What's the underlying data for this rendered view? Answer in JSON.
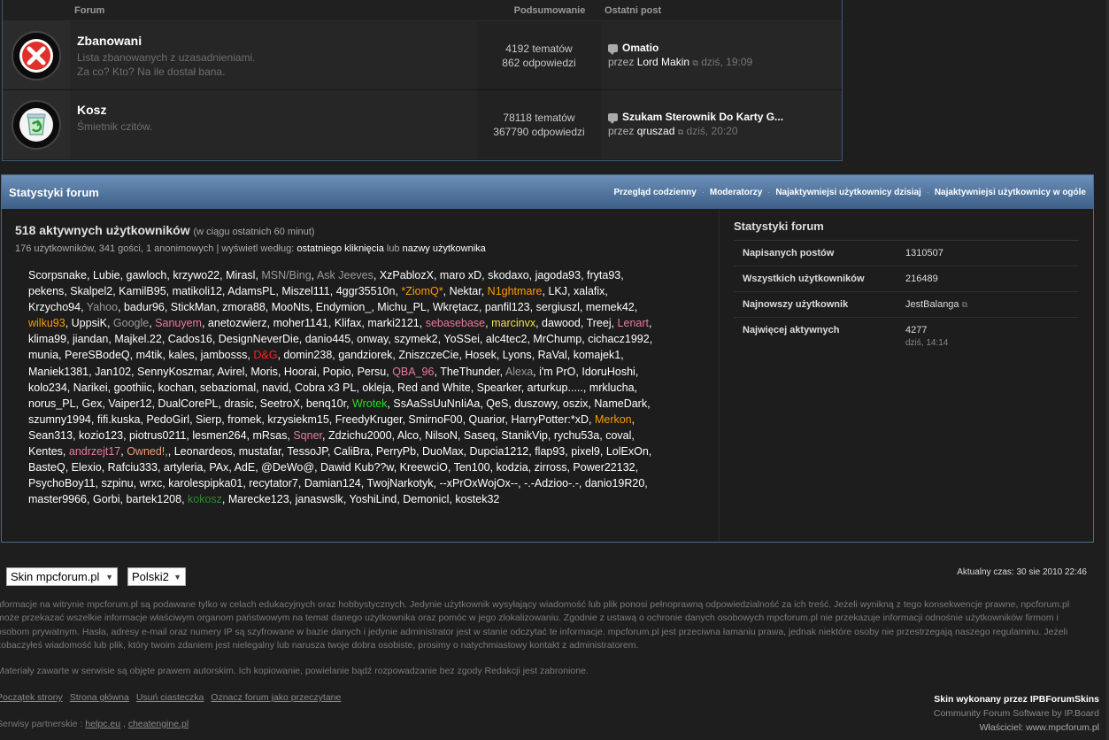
{
  "forum_table": {
    "headers": {
      "forum": "Forum",
      "summary": "Podsumowanie",
      "last_post": "Ostatni post"
    },
    "rows": [
      {
        "title": "Zbanowani",
        "desc1": "Lista zbanowanych z uzasadnieniami.",
        "desc2": "Za co? Kto? Na ile dostał bana.",
        "topics": "4192 tematów",
        "replies": "862 odpowiedzi",
        "last_topic": "Omatio",
        "by_label": "przez",
        "last_user": "Lord Makin",
        "last_time": "dziś, 19:09"
      },
      {
        "title": "Kosz",
        "desc1": "Śmietnik czitów.",
        "desc2": "",
        "topics": "78118 tematów",
        "replies": "367790 odpowiedzi",
        "last_topic": "Szukam Sterownik Do Karty G...",
        "by_label": "przez",
        "last_user": "qruszad",
        "last_time": "dziś, 20:20"
      }
    ]
  },
  "stats": {
    "title": "Statystyki forum",
    "links": [
      "Przegląd codzienny",
      "Moderatorzy",
      "Najaktywniejsi użytkownicy dzisiaj",
      "Najaktywniejsi użytkownicy w ogóle"
    ],
    "active_title": "518 aktywnych użytkowników",
    "active_sub": "(w ciągu ostatnich 60 minut)",
    "meta_prefix": "176 użytkowników, 341 gości, 1 anonimowych | wyświetl według:",
    "meta_link1": "ostatniego kliknięcia",
    "meta_or": "lub",
    "meta_link2": "nazwy użytkownika",
    "users": [
      [
        "Scorpsnake",
        ""
      ],
      [
        "Lubie",
        ""
      ],
      [
        "gawloch",
        ""
      ],
      [
        "krzywo22",
        ""
      ],
      [
        "Mirasl",
        ""
      ],
      [
        "MSN/Bing",
        "gray"
      ],
      [
        "Ask Jeeves",
        "gray"
      ],
      [
        "XzPablozX",
        ""
      ],
      [
        "maro xD",
        ""
      ],
      [
        "skodaxo",
        ""
      ],
      [
        "jagoda93",
        ""
      ],
      [
        "fryta93",
        ""
      ],
      [
        "pekens",
        ""
      ],
      [
        "Skalpel2",
        ""
      ],
      [
        "KamilB95",
        ""
      ],
      [
        "matikoli12",
        ""
      ],
      [
        "AdamsPL",
        ""
      ],
      [
        "Miszel111",
        ""
      ],
      [
        "4ggr35510n",
        ""
      ],
      [
        "*ZiomQ*",
        "orange"
      ],
      [
        "Nektar",
        ""
      ],
      [
        "N1ghtmare",
        "orange"
      ],
      [
        "LKJ",
        ""
      ],
      [
        "xalafix",
        ""
      ],
      [
        "Krzycho94",
        ""
      ],
      [
        "Yahoo",
        "gray"
      ],
      [
        "badur96",
        ""
      ],
      [
        "StickMan",
        ""
      ],
      [
        "zmora88",
        ""
      ],
      [
        "MooNts",
        ""
      ],
      [
        "Endymion_",
        ""
      ],
      [
        "Michu_PL",
        ""
      ],
      [
        "Wkrętacz",
        ""
      ],
      [
        "panfil123",
        ""
      ],
      [
        "sergiuszl",
        ""
      ],
      [
        "memek42",
        ""
      ],
      [
        "wilku93",
        "orange"
      ],
      [
        "UppsiK",
        ""
      ],
      [
        "Google",
        "gray"
      ],
      [
        "Sanuyem",
        "pink"
      ],
      [
        "anetozwierz",
        ""
      ],
      [
        "moher1141",
        ""
      ],
      [
        "Klifax",
        ""
      ],
      [
        "marki2121",
        ""
      ],
      [
        "sebasebase",
        "pink"
      ],
      [
        "marcinvx",
        "yellow"
      ],
      [
        "dawood",
        ""
      ],
      [
        "Treej",
        ""
      ],
      [
        "Lenart",
        "pink"
      ],
      [
        "klima99",
        ""
      ],
      [
        "jiandan",
        ""
      ],
      [
        "Majkel.22",
        ""
      ],
      [
        "Cados16",
        ""
      ],
      [
        "DesignNeverDie",
        ""
      ],
      [
        "danio445",
        ""
      ],
      [
        "onway",
        ""
      ],
      [
        "szymek2",
        ""
      ],
      [
        "YoSSei",
        ""
      ],
      [
        "alc4tec2",
        ""
      ],
      [
        "MrChump",
        ""
      ],
      [
        "cichacz1992",
        ""
      ],
      [
        "munia",
        ""
      ],
      [
        "PereSBodeQ",
        ""
      ],
      [
        "m4tik",
        ""
      ],
      [
        "kales",
        ""
      ],
      [
        "jambosss",
        ""
      ],
      [
        "D&G",
        "red"
      ],
      [
        "domin238",
        ""
      ],
      [
        "gandziorek",
        ""
      ],
      [
        "ZniszczeCie",
        ""
      ],
      [
        "Hosek",
        ""
      ],
      [
        "Lyons",
        ""
      ],
      [
        "RaVal",
        ""
      ],
      [
        "komajek1",
        ""
      ],
      [
        "Maniek1381",
        ""
      ],
      [
        "Jan102",
        ""
      ],
      [
        "SennyKoszmar",
        ""
      ],
      [
        "Avirel",
        ""
      ],
      [
        "Moris",
        ""
      ],
      [
        "Hoorai",
        ""
      ],
      [
        "Popio",
        ""
      ],
      [
        "Persu",
        ""
      ],
      [
        "QBA_96",
        "pink"
      ],
      [
        "TheThunder",
        ""
      ],
      [
        "Alexa",
        "gray"
      ],
      [
        "i'm PrO",
        ""
      ],
      [
        "IdoruHoshi",
        ""
      ],
      [
        "kolo234",
        ""
      ],
      [
        "Narikei",
        ""
      ],
      [
        "goothiic",
        ""
      ],
      [
        "kochan",
        ""
      ],
      [
        "sebaziomal",
        ""
      ],
      [
        "navid",
        ""
      ],
      [
        "Cobra x3 PL",
        ""
      ],
      [
        "okleja",
        ""
      ],
      [
        "Red and White",
        ""
      ],
      [
        "Spearker",
        ""
      ],
      [
        "arturkup.....",
        ""
      ],
      [
        "mrklucha",
        ""
      ],
      [
        "norus_PL",
        ""
      ],
      [
        "Gex",
        ""
      ],
      [
        "Vaiper12",
        ""
      ],
      [
        "DualCorePL",
        ""
      ],
      [
        "drasic",
        ""
      ],
      [
        "SeetroX",
        ""
      ],
      [
        "benq10r",
        ""
      ],
      [
        "Wrotek",
        "green"
      ],
      [
        "SsAaSsUuNnIiAa",
        ""
      ],
      [
        "QeS",
        ""
      ],
      [
        "duszowy",
        ""
      ],
      [
        "oszix",
        ""
      ],
      [
        "NameDark",
        ""
      ],
      [
        "szumny1994",
        ""
      ],
      [
        "fifi.kuska",
        ""
      ],
      [
        "PedoGirl",
        ""
      ],
      [
        "Sierp",
        ""
      ],
      [
        "fromek",
        ""
      ],
      [
        "krzysiekm15",
        ""
      ],
      [
        "FreedyKruger",
        ""
      ],
      [
        "SmirnoF00",
        ""
      ],
      [
        "Quarior",
        ""
      ],
      [
        "HarryPotter:*xD",
        ""
      ],
      [
        "Merkon",
        "orange"
      ],
      [
        "Sean313",
        ""
      ],
      [
        "kozio123",
        ""
      ],
      [
        "piotrus0211",
        ""
      ],
      [
        "lesmen264",
        ""
      ],
      [
        "mRsas",
        ""
      ],
      [
        "Sqner",
        "pink"
      ],
      [
        "Zdzichu2000",
        ""
      ],
      [
        "Alco",
        ""
      ],
      [
        "NilsoN",
        ""
      ],
      [
        "Saseq",
        ""
      ],
      [
        "StanikVip",
        ""
      ],
      [
        "rychu53a",
        ""
      ],
      [
        "coval",
        ""
      ],
      [
        "Kentes",
        ""
      ],
      [
        "andrzejt17",
        "pink"
      ],
      [
        "Owned!,",
        "peach"
      ],
      [
        "Leonardeos",
        ""
      ],
      [
        "mustafar",
        ""
      ],
      [
        "TessoJP",
        ""
      ],
      [
        "CaliBra",
        ""
      ],
      [
        "PerryPb",
        ""
      ],
      [
        "DuoMax",
        ""
      ],
      [
        "Dupcia1212",
        ""
      ],
      [
        "flap93",
        ""
      ],
      [
        "pixel9",
        ""
      ],
      [
        "LolExOn",
        ""
      ],
      [
        "BasteQ",
        ""
      ],
      [
        "Elexio",
        ""
      ],
      [
        "Rafciu333",
        ""
      ],
      [
        "artyleria",
        ""
      ],
      [
        "PAx",
        ""
      ],
      [
        "AdE",
        ""
      ],
      [
        "@DeWo@",
        ""
      ],
      [
        "Dawid Kub??w",
        ""
      ],
      [
        "KreewciO",
        ""
      ],
      [
        "Ten100",
        ""
      ],
      [
        "kodzia",
        ""
      ],
      [
        "zirross",
        ""
      ],
      [
        "Power22132",
        ""
      ],
      [
        "PsychoBoy11",
        ""
      ],
      [
        "szpinu",
        ""
      ],
      [
        "wrxc",
        ""
      ],
      [
        "karolespipka01",
        ""
      ],
      [
        "recytator7",
        ""
      ],
      [
        "Damian124",
        ""
      ],
      [
        "TwojNarkotyk",
        ""
      ],
      [
        "--xPrOxWojOx--",
        ""
      ],
      [
        "-.-Adzioo-.-",
        ""
      ],
      [
        "danio19R20",
        ""
      ],
      [
        "master9966",
        ""
      ],
      [
        "Gorbi",
        ""
      ],
      [
        "bartek1208",
        ""
      ],
      [
        "kokosz",
        "dgreen"
      ],
      [
        "Marecke123",
        ""
      ],
      [
        "janaswslk",
        ""
      ],
      [
        "YoshiLind",
        ""
      ],
      [
        "Demonicl",
        ""
      ],
      [
        "kostek32",
        ""
      ]
    ],
    "right_title": "Statystyki forum",
    "right_rows": [
      {
        "key": "Napisanych postów",
        "value": "1310507",
        "sub": ""
      },
      {
        "key": "Wszystkich użytkowników",
        "value": "216489",
        "sub": ""
      },
      {
        "key": "Najnowszy użytkownik",
        "value": "JestBalanga",
        "sub": ""
      },
      {
        "key": "Najwięcej aktywnych",
        "value": "4277",
        "sub": "dziś, 14:14"
      }
    ]
  },
  "footer": {
    "skin_select": "Skin mpcforum.pl",
    "lang_select": "Polski2",
    "time": "Aktualny czas: 30 sie 2010 22:46",
    "disclaimer": "nformacje na witrynie mpcforum.pl są podawane tylko w celach edukacyjnych oraz hobbystycznych. Jedynie użytkownik wysyłający wiadomość lub plik ponosi pełnoprawną odpowiedzialność za ich treść. Jeżeli wynikną z tego konsekwencje prawne, npcforum.pl może przekazać wszelkie informacje właściwym organom państwowym na temat danego użytkownika oraz pomóc w jego zlokalizowaniu. Zgodnie z ustawą o ochronie danych osobowych mpcforum.pl nie przekazuje informacji odnośnie użytkowników firmom i osobom prywatnym. Hasła, adresy e-mail oraz numery IP są szyfrowane w bazie danych i jedynie administrator jest w stanie odczytać te informacje. mpcforum.pl jest przeciwna łamaniu prawa, jednak niektóre osoby nie przestrzegają naszego regulaminu. Jeżeli zobaczyłeś wiadomość lub plik, który twoim zdaniem jest nielegalny lub narusza twoje dobra osobiste, prosimy o natychmiastowy kontakt z administratorem.",
    "copyright": "Materiały zawarte w serwisie są objęte prawem autorskim. Ich kopiowanie, powielanie bądź rozpowadzanie bez zgody Redakcji jest zabronione.",
    "links": [
      "Początek strony",
      "Strona główna",
      "Usuń ciasteczka",
      "Oznacz forum jako przeczytane"
    ],
    "partners_label": "Serwisy partnerskie :",
    "partner1": "helpc.eu",
    "partner2": "cheatengine.pl",
    "credit1": "Skin wykonany przez IPBForumSkins",
    "credit2": "Community Forum Software by IP.Board",
    "credit3": "Właściciel: www.mpcforum.pl"
  }
}
